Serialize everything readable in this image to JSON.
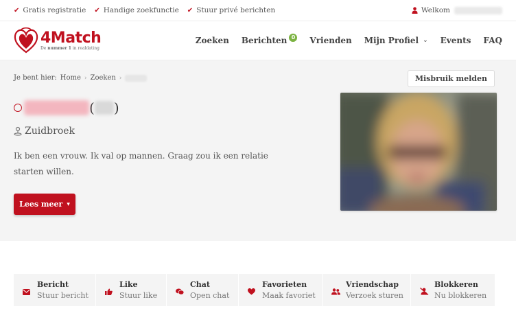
{
  "topbar": {
    "usps": [
      "Gratis registratie",
      "Handige zoekfunctie",
      "Stuur privé berichten"
    ],
    "welcome_label": "Welkom"
  },
  "header": {
    "brand": "4Match",
    "tagline_pre": "De ",
    "tagline_bold": "nummer 1",
    "tagline_post": " in realdating",
    "nav": {
      "search": "Zoeken",
      "messages": "Berichten",
      "messages_badge": "0",
      "friends": "Vrienden",
      "my_profile": "Mijn Profiel",
      "events": "Events",
      "faq": "FAQ"
    }
  },
  "breadcrumb": {
    "prefix": "Je bent hier:",
    "home": "Home",
    "search": "Zoeken"
  },
  "report_button": "Misbruik melden",
  "profile": {
    "location": "Zuidbroek",
    "bio": "Ik ben een vrouw. Ik val op mannen. Graag zou ik een relatie starten willen.",
    "read_more": "Lees meer"
  },
  "actions": [
    {
      "title": "Bericht",
      "subtitle": "Stuur bericht",
      "icon": "envelope-icon"
    },
    {
      "title": "Like",
      "subtitle": "Stuur like",
      "icon": "thumbs-up-icon"
    },
    {
      "title": "Chat",
      "subtitle": "Open chat",
      "icon": "chat-bubbles-icon"
    },
    {
      "title": "Favorieten",
      "subtitle": "Maak favoriet",
      "icon": "heart-icon"
    },
    {
      "title": "Vriendschap",
      "subtitle": "Verzoek sturen",
      "icon": "users-icon"
    },
    {
      "title": "Blokkeren",
      "subtitle": "Nu blokkeren",
      "icon": "user-block-icon"
    }
  ],
  "colors": {
    "brand_red": "#c0111f",
    "badge_green": "#7cb342",
    "hero_bg": "#f4f4f4"
  }
}
